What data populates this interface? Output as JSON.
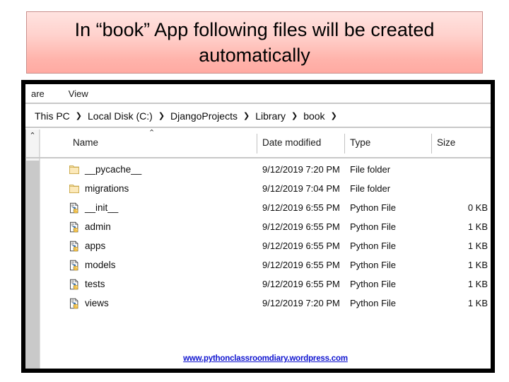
{
  "banner": {
    "text": "In “book” App following files will be created automatically",
    "bg_top": "#ffe3e0",
    "bg_bottom": "#ffaaa2",
    "border_color": "#c98f8c"
  },
  "explorer": {
    "ribbon_tabs": [
      {
        "label": "are",
        "name": "tab-share"
      },
      {
        "label": "View",
        "name": "tab-view"
      }
    ],
    "breadcrumb": {
      "separator": "❯",
      "items": [
        "This PC",
        "Local Disk (C:)",
        "DjangoProjects",
        "Library",
        "book"
      ],
      "trailing_separator": "❯"
    },
    "columns": {
      "name": "Name",
      "date_modified": "Date modified",
      "type": "Type",
      "size": "Size",
      "sort_indicator": "⌃"
    },
    "nav_scroll_caret": "⌃",
    "rows": [
      {
        "icon": "folder-icon",
        "name": "__pycache__",
        "date_modified": "9/12/2019 7:20 PM",
        "type": "File folder",
        "size": ""
      },
      {
        "icon": "folder-icon",
        "name": "migrations",
        "date_modified": "9/12/2019 7:04 PM",
        "type": "File folder",
        "size": ""
      },
      {
        "icon": "python-file-icon",
        "name": "__init__",
        "date_modified": "9/12/2019 6:55 PM",
        "type": "Python File",
        "size": "0 KB"
      },
      {
        "icon": "python-file-icon",
        "name": "admin",
        "date_modified": "9/12/2019 6:55 PM",
        "type": "Python File",
        "size": "1 KB"
      },
      {
        "icon": "python-file-icon",
        "name": "apps",
        "date_modified": "9/12/2019 6:55 PM",
        "type": "Python File",
        "size": "1 KB"
      },
      {
        "icon": "python-file-icon",
        "name": "models",
        "date_modified": "9/12/2019 6:55 PM",
        "type": "Python File",
        "size": "1 KB"
      },
      {
        "icon": "python-file-icon",
        "name": "tests",
        "date_modified": "9/12/2019 6:55 PM",
        "type": "Python File",
        "size": "1 KB"
      },
      {
        "icon": "python-file-icon",
        "name": "views",
        "date_modified": "9/12/2019 7:20 PM",
        "type": "Python File",
        "size": "1 KB"
      }
    ]
  },
  "footer": {
    "link_text": "www.pythonclassroomdiary.wordpress.com",
    "link_color": "#1015d0"
  }
}
